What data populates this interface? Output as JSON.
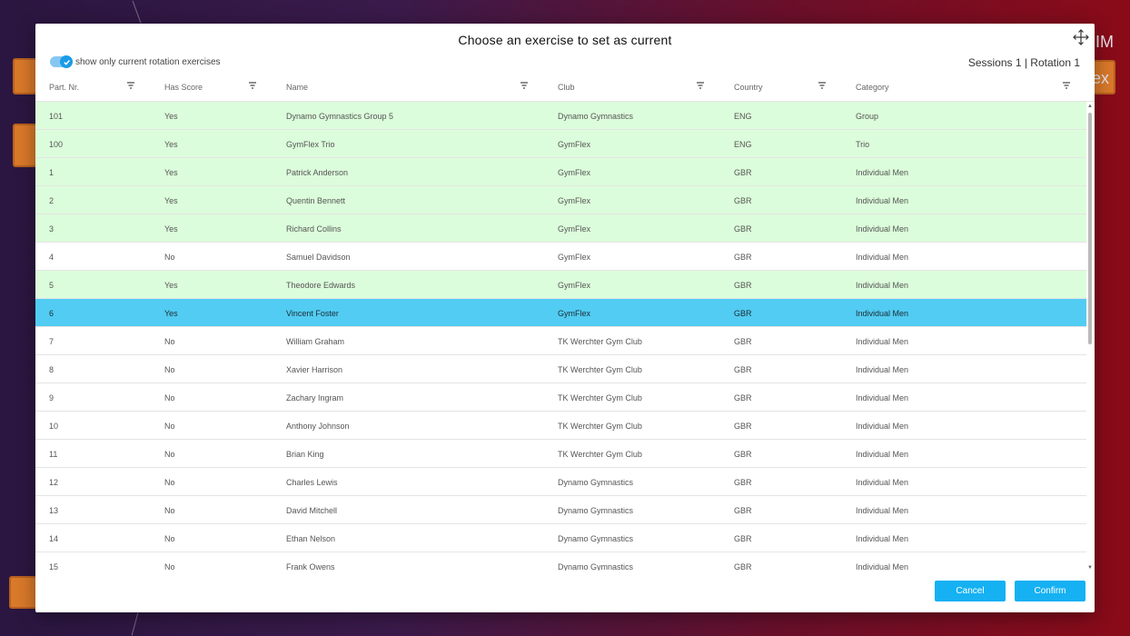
{
  "background": {
    "right_text_1": "IM",
    "right_text_2": "ex"
  },
  "dialog": {
    "title": "Choose an exercise to set as current",
    "toggle_label": "show only current rotation exercises",
    "toggle_on": true,
    "session_info": "Sessions 1 | Rotation 1",
    "cancel_label": "Cancel",
    "confirm_label": "Confirm"
  },
  "grid": {
    "columns": [
      {
        "key": "part",
        "label": "Part. Nr."
      },
      {
        "key": "score",
        "label": "Has Score"
      },
      {
        "key": "name",
        "label": "Name"
      },
      {
        "key": "club",
        "label": "Club"
      },
      {
        "key": "country",
        "label": "Country"
      },
      {
        "key": "category",
        "label": "Category"
      }
    ],
    "rows": [
      {
        "part": "101",
        "score": "Yes",
        "name": "Dynamo Gymnastics Group 5",
        "club": "Dynamo Gymnastics",
        "country": "ENG",
        "category": "Group",
        "state": "scored"
      },
      {
        "part": "100",
        "score": "Yes",
        "name": "GymFlex Trio",
        "club": "GymFlex",
        "country": "ENG",
        "category": "Trio",
        "state": "scored"
      },
      {
        "part": "1",
        "score": "Yes",
        "name": "Patrick Anderson",
        "club": "GymFlex",
        "country": "GBR",
        "category": "Individual Men",
        "state": "scored"
      },
      {
        "part": "2",
        "score": "Yes",
        "name": "Quentin Bennett",
        "club": "GymFlex",
        "country": "GBR",
        "category": "Individual Men",
        "state": "scored"
      },
      {
        "part": "3",
        "score": "Yes",
        "name": "Richard Collins",
        "club": "GymFlex",
        "country": "GBR",
        "category": "Individual Men",
        "state": "scored"
      },
      {
        "part": "4",
        "score": "No",
        "name": "Samuel Davidson",
        "club": "GymFlex",
        "country": "GBR",
        "category": "Individual Men",
        "state": "plain"
      },
      {
        "part": "5",
        "score": "Yes",
        "name": "Theodore Edwards",
        "club": "GymFlex",
        "country": "GBR",
        "category": "Individual Men",
        "state": "scored"
      },
      {
        "part": "6",
        "score": "Yes",
        "name": "Vincent Foster",
        "club": "GymFlex",
        "country": "GBR",
        "category": "Individual Men",
        "state": "selected"
      },
      {
        "part": "7",
        "score": "No",
        "name": "William Graham",
        "club": "TK Werchter Gym Club",
        "country": "GBR",
        "category": "Individual Men",
        "state": "plain"
      },
      {
        "part": "8",
        "score": "No",
        "name": "Xavier Harrison",
        "club": "TK Werchter Gym Club",
        "country": "GBR",
        "category": "Individual Men",
        "state": "plain"
      },
      {
        "part": "9",
        "score": "No",
        "name": "Zachary Ingram",
        "club": "TK Werchter Gym Club",
        "country": "GBR",
        "category": "Individual Men",
        "state": "plain"
      },
      {
        "part": "10",
        "score": "No",
        "name": "Anthony Johnson",
        "club": "TK Werchter Gym Club",
        "country": "GBR",
        "category": "Individual Men",
        "state": "plain"
      },
      {
        "part": "11",
        "score": "No",
        "name": "Brian King",
        "club": "TK Werchter Gym Club",
        "country": "GBR",
        "category": "Individual Men",
        "state": "plain"
      },
      {
        "part": "12",
        "score": "No",
        "name": "Charles Lewis",
        "club": "Dynamo Gymnastics",
        "country": "GBR",
        "category": "Individual Men",
        "state": "plain"
      },
      {
        "part": "13",
        "score": "No",
        "name": "David Mitchell",
        "club": "Dynamo Gymnastics",
        "country": "GBR",
        "category": "Individual Men",
        "state": "plain"
      },
      {
        "part": "14",
        "score": "No",
        "name": "Ethan Nelson",
        "club": "Dynamo Gymnastics",
        "country": "GBR",
        "category": "Individual Men",
        "state": "plain"
      },
      {
        "part": "15",
        "score": "No",
        "name": "Frank Owens",
        "club": "Dynamo Gymnastics",
        "country": "GBR",
        "category": "Individual Men",
        "state": "plain"
      }
    ]
  },
  "colors": {
    "scored_row": "#dcfddb",
    "selected_row": "#52ccf2",
    "accent": "#16b1f2"
  },
  "icons": {
    "move": "move-arrows-icon",
    "filter": "filter-icon",
    "check": "check-icon"
  }
}
